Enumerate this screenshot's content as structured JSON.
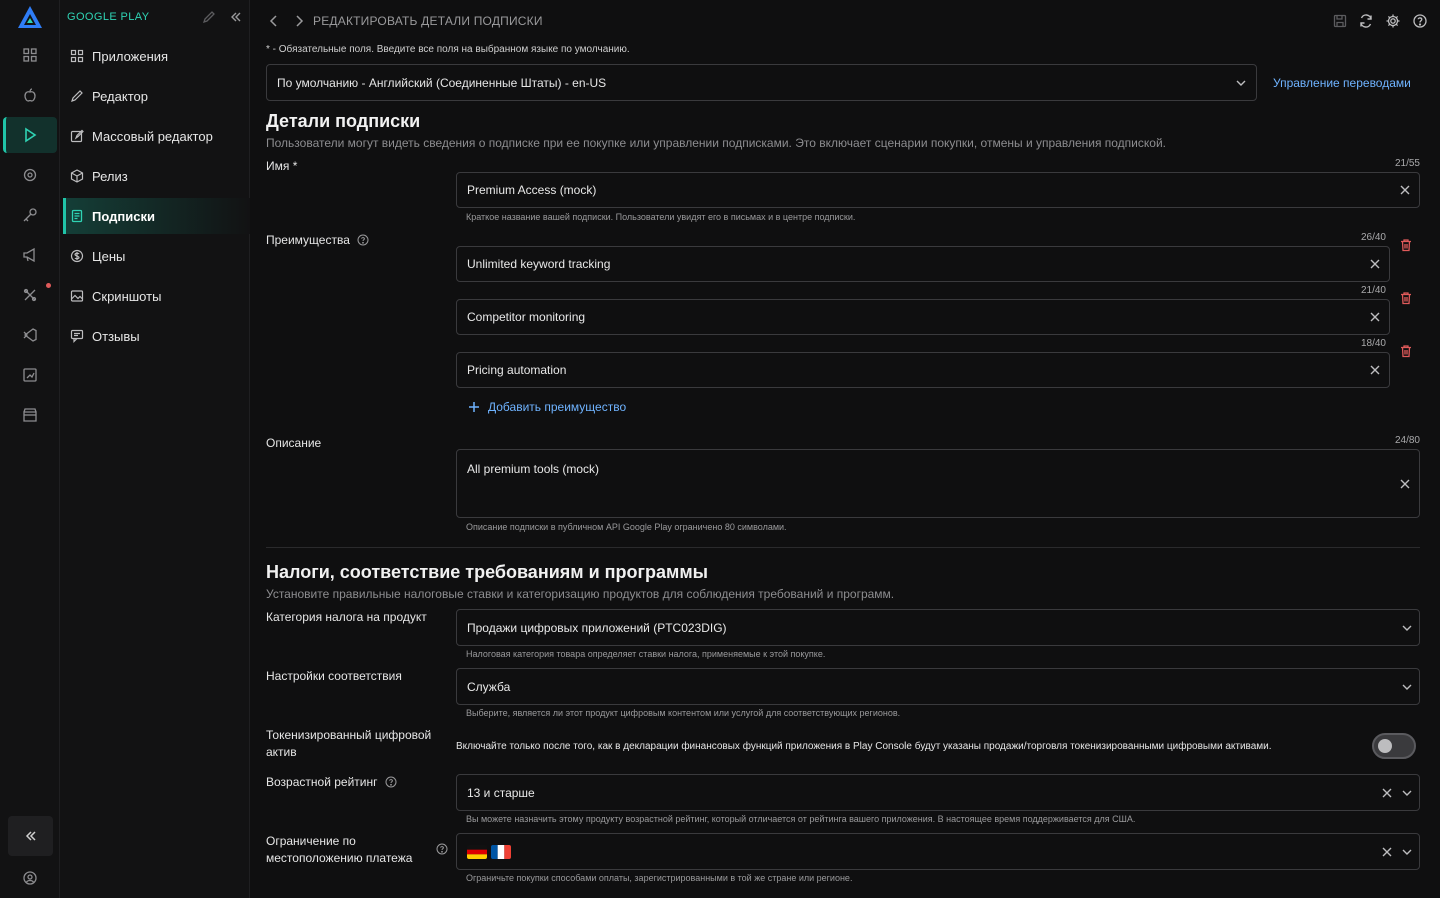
{
  "sidebar": {
    "title": "GOOGLE PLAY",
    "items": [
      {
        "label": "Приложения",
        "icon": "apps-grid-icon"
      },
      {
        "label": "Редактор",
        "icon": "pencil-icon"
      },
      {
        "label": "Массовый редактор",
        "icon": "bulk-edit-icon"
      },
      {
        "label": "Релиз",
        "icon": "package-icon"
      },
      {
        "label": "Подписки",
        "icon": "receipt-icon",
        "active": true
      },
      {
        "label": "Цены",
        "icon": "dollar-circle-icon"
      },
      {
        "label": "Скриншоты",
        "icon": "image-icon"
      },
      {
        "label": "Отзывы",
        "icon": "reviews-icon"
      }
    ]
  },
  "topbar": {
    "title": "РЕДАКТИРОВАТЬ ДЕТАЛИ ПОДПИСКИ"
  },
  "note": "* - Обязательные поля. Введите все поля на выбранном языке по умолчанию.",
  "language": {
    "selected": "По умолчанию - Английский (Соединенные Штаты) - en-US",
    "manage_link": "Управление переводами"
  },
  "details": {
    "title": "Детали подписки",
    "description": "Пользователи могут видеть сведения о подписке при ее покупке или управлении подписками. Это включает сценарии покупки, отмены и управления подпиской.",
    "name": {
      "label": "Имя *",
      "value": "Premium Access (mock)",
      "counter": "21/55",
      "hint": "Краткое название вашей подписки. Пользователи увидят его в письмах и в центре подписки."
    },
    "benefits": {
      "label": "Преимущества",
      "items": [
        {
          "value": "Unlimited keyword tracking",
          "counter": "26/40"
        },
        {
          "value": "Competitor monitoring",
          "counter": "21/40"
        },
        {
          "value": "Pricing automation",
          "counter": "18/40"
        }
      ],
      "add_label": "Добавить преимущество"
    },
    "description_field": {
      "label": "Описание",
      "value": "All premium tools (mock)",
      "counter": "24/80",
      "hint": "Описание подписки в публичном API Google Play ограничено 80 символами."
    }
  },
  "taxes": {
    "title": "Налоги, соответствие требованиям и программы",
    "description": "Установите правильные налоговые ставки и категоризацию продуктов для соблюдения требований и программ.",
    "tax_category": {
      "label": "Категория налога на продукт",
      "value": "Продажи цифровых приложений (PTC023DIG)",
      "hint": "Налоговая категория товара определяет ставки налога, применяемые к этой покупке."
    },
    "compliance": {
      "label": "Настройки соответствия",
      "value": "Служба",
      "hint": "Выберите, является ли этот продукт цифровым контентом или услугой для соответствующих регионов."
    },
    "tokenized": {
      "label": "Токенизированный цифровой актив",
      "text": "Включайте только после того, как в декларации финансовых функций приложения в Play Console будут указаны продажи/торговля токенизированными цифровыми активами.",
      "enabled": false
    },
    "age_rating": {
      "label": "Возрастной рейтинг",
      "value": "13 и старше",
      "hint": "Вы можете назначить этому продукту возрастной рейтинг, который отличается от рейтинга вашего приложения. В настоящее время поддерживается для США."
    },
    "payment_location": {
      "label": "Ограничение по местоположению платежа",
      "flags": [
        "de",
        "fr"
      ],
      "hint": "Ограничьте покупки способами оплаты, зарегистрированными в той же стране или регионе."
    }
  },
  "colors": {
    "accent": "#20c4a8",
    "link": "#6fb3ff",
    "danger": "#e05a5a"
  }
}
